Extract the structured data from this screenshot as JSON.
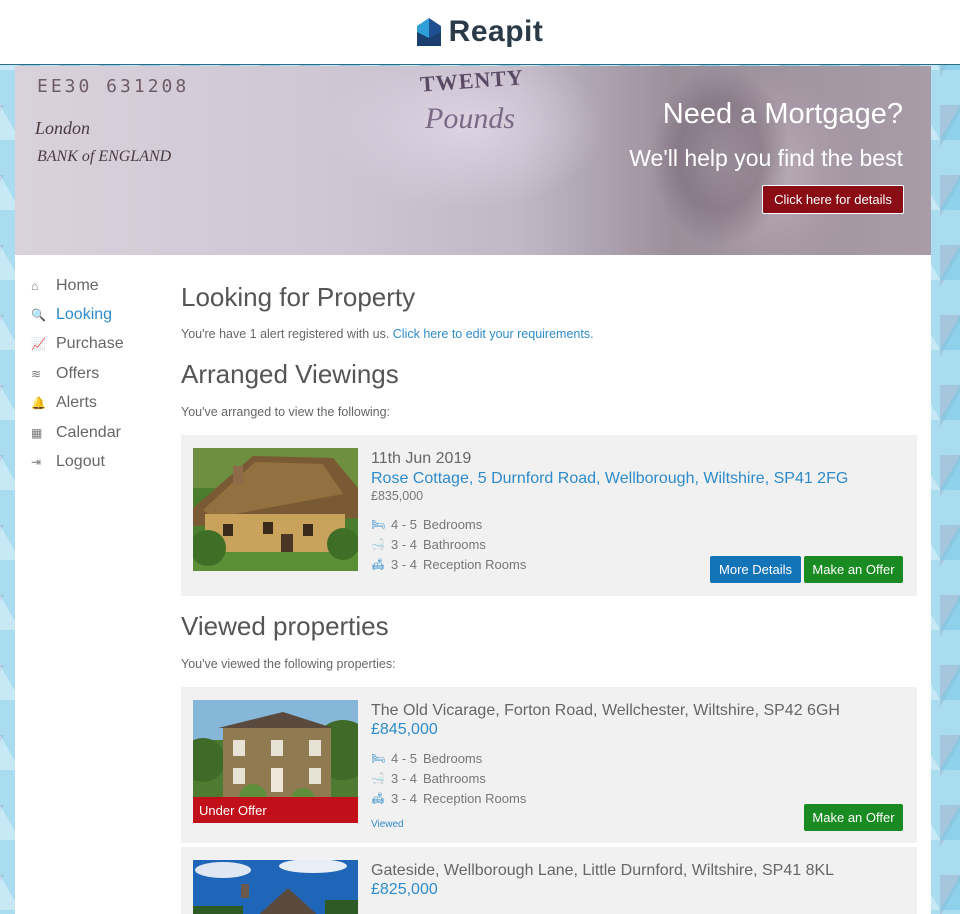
{
  "brand": {
    "name": "Reapit"
  },
  "hero": {
    "title": "Need a Mortgage?",
    "subtitle": "We'll help you find the best",
    "button": "Click here for details",
    "banknote_serial": "EE30 631208",
    "banknote_value": "TWENTY",
    "banknote_script": "Pounds",
    "banknote_script_left": "London",
    "banknote_bank": "BANK of ENGLAND"
  },
  "sidebar": {
    "items": [
      {
        "label": "Home",
        "icon": "home-icon",
        "glyph": "⌂",
        "active": false
      },
      {
        "label": "Looking",
        "icon": "search-icon",
        "glyph": "🔍",
        "active": true
      },
      {
        "label": "Purchase",
        "icon": "chart-icon",
        "glyph": "📈",
        "active": false
      },
      {
        "label": "Offers",
        "icon": "layers-icon",
        "glyph": "≋",
        "active": false
      },
      {
        "label": "Alerts",
        "icon": "bell-icon",
        "glyph": "🔔",
        "active": false
      },
      {
        "label": "Calendar",
        "icon": "calendar-icon",
        "glyph": "▦",
        "active": false
      },
      {
        "label": "Logout",
        "icon": "logout-icon",
        "glyph": "⇥",
        "active": false
      }
    ]
  },
  "looking": {
    "title": "Looking for Property",
    "text": "You're have 1 alert registered with us.",
    "link": "Click here to edit your requirements."
  },
  "arranged": {
    "title": "Arranged Viewings",
    "text": "You've arranged to view the following:",
    "items": [
      {
        "date": "11th Jun 2019",
        "address_parts": [
          "Rose Cottage",
          "5 Durnford Road",
          "Wellborough",
          "Wiltshire",
          "SP41 2FG"
        ],
        "price": "£835,000",
        "bedrooms": "4 - 5",
        "bedrooms_label": "Bedrooms",
        "bathrooms": "3 - 4",
        "bathrooms_label": "Bathrooms",
        "reception": "3 - 4",
        "reception_label": "Reception Rooms",
        "more_details": "More Details",
        "make_offer": "Make an Offer"
      }
    ]
  },
  "viewed": {
    "title": "Viewed properties",
    "text": "You've viewed the following properties:",
    "items": [
      {
        "address": "The Old Vicarage, Forton Road, Wellchester, Wiltshire, SP42 6GH",
        "price": "£845,000",
        "bedrooms": "4 - 5",
        "bedrooms_label": "Bedrooms",
        "bathrooms": "3 - 4",
        "bathrooms_label": "Bathrooms",
        "reception": "3 - 4",
        "reception_label": "Reception Rooms",
        "status": "Viewed",
        "badge": "Under Offer",
        "make_offer": "Make an Offer"
      },
      {
        "address": "Gateside, Wellborough Lane, Little Durnford, Wiltshire, SP41 8KL",
        "price": "£825,000"
      }
    ]
  },
  "colors": {
    "accent": "#2e8bc9",
    "btn_blue": "#1474b8",
    "btn_green": "#1a8a22",
    "hero_btn": "#8a0d16",
    "under_offer": "#c1101a"
  }
}
